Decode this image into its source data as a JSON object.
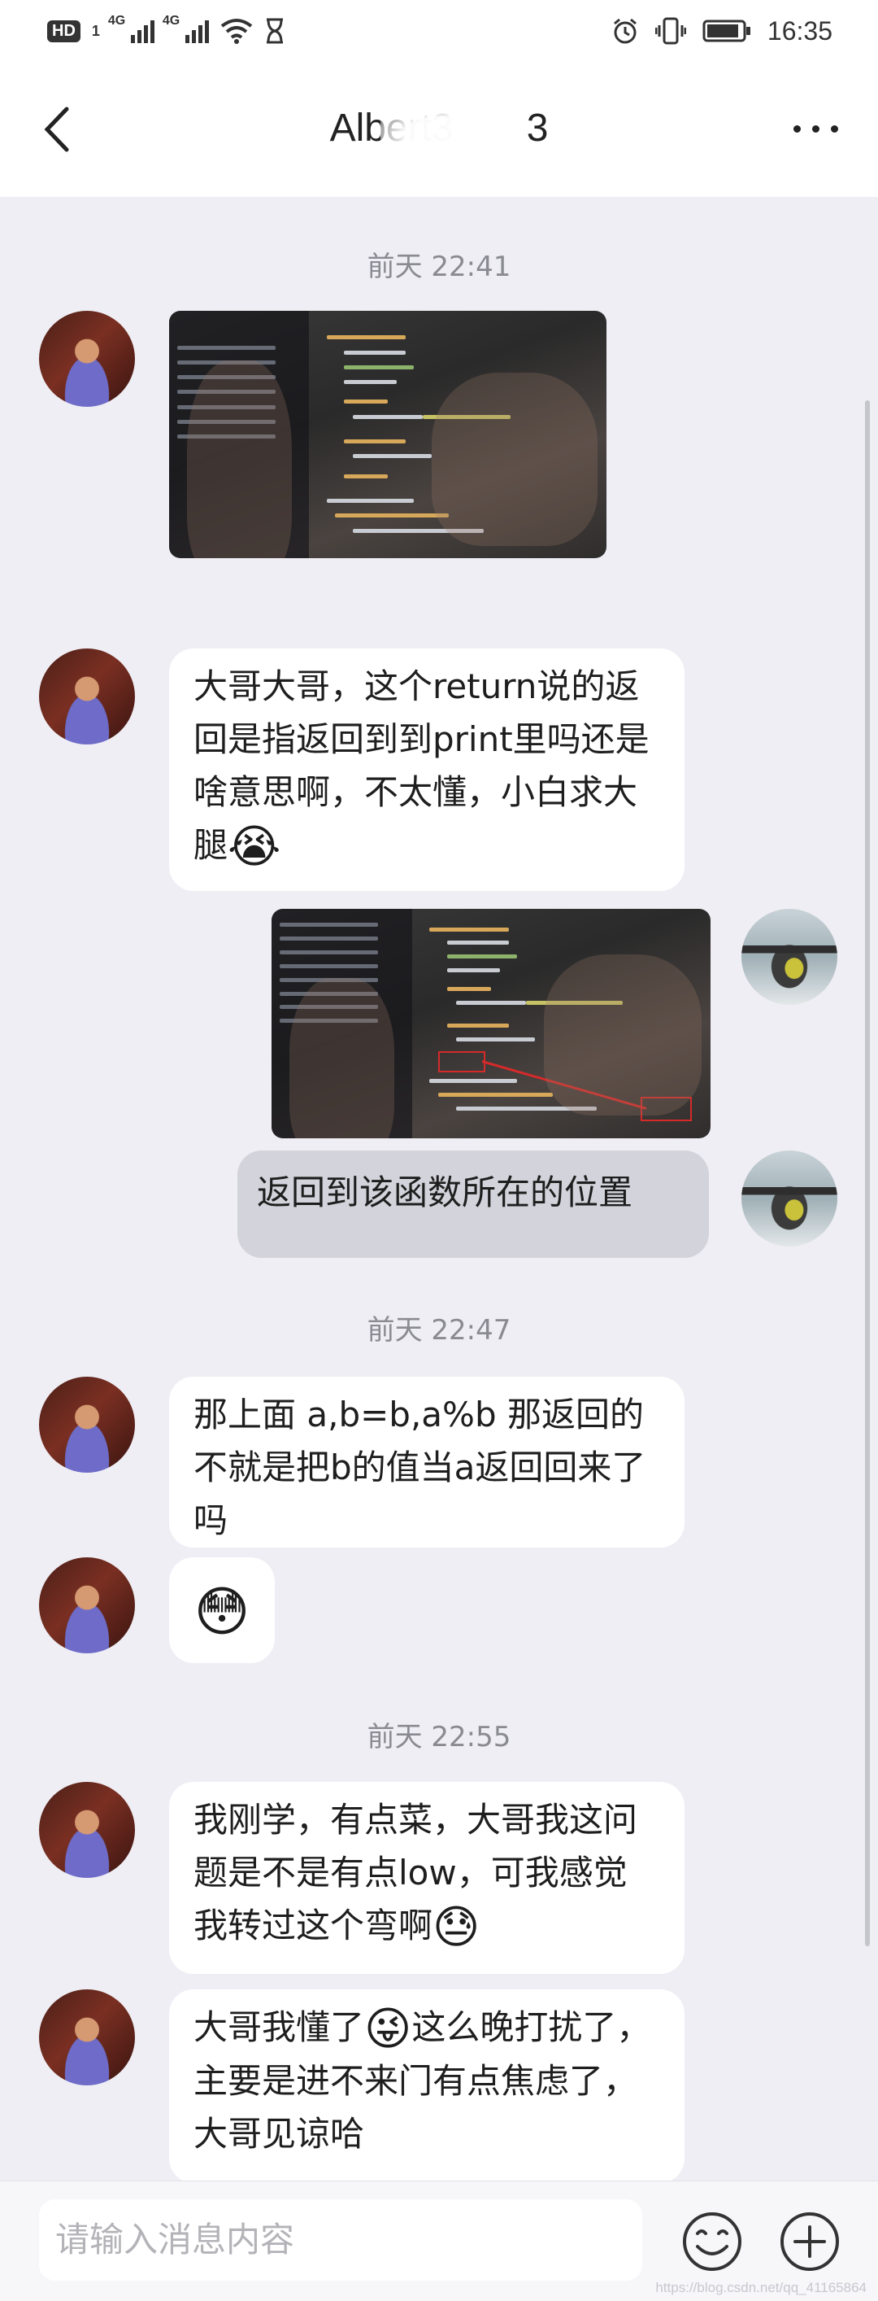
{
  "status_bar": {
    "hd": "HD",
    "hd_sub": "1",
    "signal1": "4G",
    "signal2": "4G",
    "time": "16:35"
  },
  "header": {
    "title": "Albert3",
    "title_tail": "3"
  },
  "messages": [
    {
      "type": "timestamp",
      "text": "前天 22:41"
    },
    {
      "type": "image",
      "from": "friend"
    },
    {
      "type": "text",
      "from": "friend",
      "text": "大哥大哥，这个return说的返回是指返回到到print里吗还是啥意思啊，不太懂，小白求大腿",
      "emoji": "😭"
    },
    {
      "type": "image",
      "from": "me"
    },
    {
      "type": "text",
      "from": "me",
      "text": "返回到该函数所在的位置"
    },
    {
      "type": "timestamp",
      "text": "前天 22:47"
    },
    {
      "type": "text",
      "from": "friend",
      "text": "那上面 a,b=b,a%b 那返回的不就是把b的值当a返回回来了吗"
    },
    {
      "type": "emoji",
      "from": "friend",
      "emoji": "😳"
    },
    {
      "type": "timestamp",
      "text": "前天 22:55"
    },
    {
      "type": "text",
      "from": "friend",
      "text": "我刚学，有点菜，大哥我这问题是不是有点low，可我感觉我转过这个弯啊",
      "emoji": "😓"
    },
    {
      "type": "text",
      "from": "friend",
      "text_a": "大哥我懂了",
      "emoji": "😜",
      "text_b": "这么晚打扰了，主要是进不来门有点焦虑了，大哥见谅哈"
    }
  ],
  "input": {
    "placeholder": "请输入消息内容"
  },
  "watermark": "https://blog.csdn.net/qq_41165864"
}
